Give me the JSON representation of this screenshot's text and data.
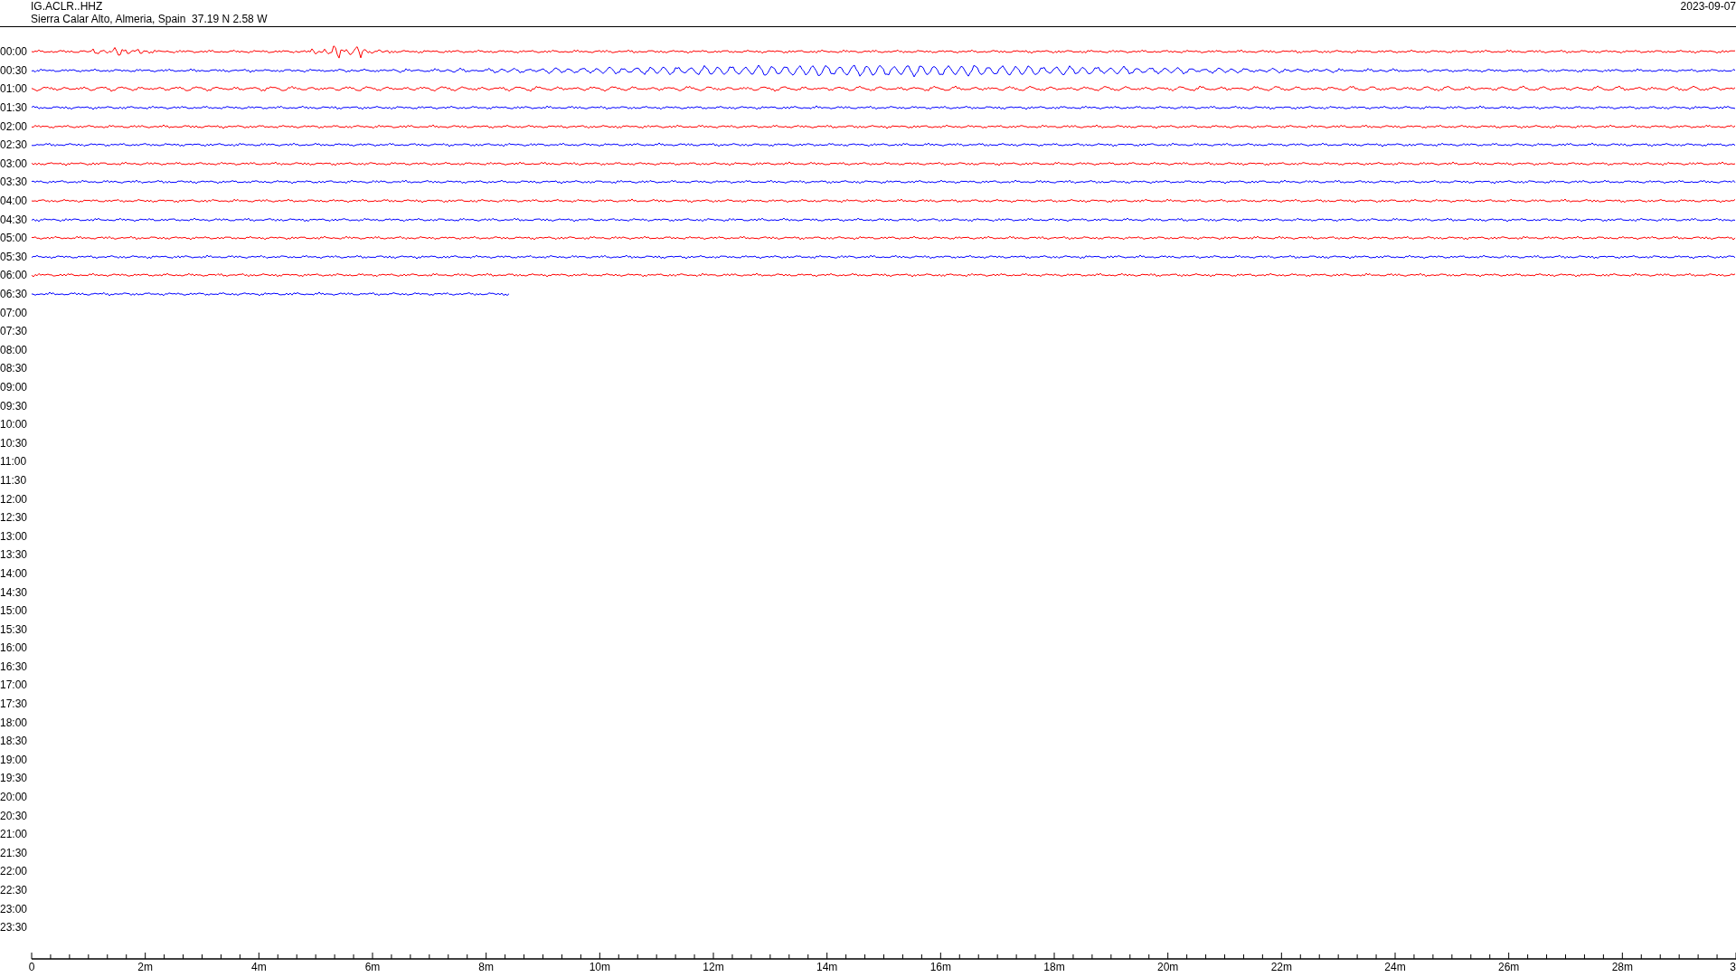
{
  "header": {
    "station": "IG.ACLR..HHZ",
    "location": "Sierra Calar Alto, Almeria, Spain  37.19 N 2.58 W",
    "date": "2023-09-07"
  },
  "rows": [
    {
      "label": "00:00",
      "color": "#ff0000",
      "kind": "full"
    },
    {
      "label": "00:30",
      "color": "#0000ff",
      "kind": "full"
    },
    {
      "label": "01:00",
      "color": "#ff0000",
      "kind": "full"
    },
    {
      "label": "01:30",
      "color": "#0000ff",
      "kind": "full"
    },
    {
      "label": "02:00",
      "color": "#ff0000",
      "kind": "full"
    },
    {
      "label": "02:30",
      "color": "#0000ff",
      "kind": "full"
    },
    {
      "label": "03:00",
      "color": "#ff0000",
      "kind": "full"
    },
    {
      "label": "03:30",
      "color": "#0000ff",
      "kind": "full"
    },
    {
      "label": "04:00",
      "color": "#ff0000",
      "kind": "full"
    },
    {
      "label": "04:30",
      "color": "#0000ff",
      "kind": "full"
    },
    {
      "label": "05:00",
      "color": "#ff0000",
      "kind": "full"
    },
    {
      "label": "05:30",
      "color": "#0000ff",
      "kind": "full"
    },
    {
      "label": "06:00",
      "color": "#ff0000",
      "kind": "full"
    },
    {
      "label": "06:30",
      "color": "#0000ff",
      "kind": "partial"
    },
    {
      "label": "07:00",
      "kind": "empty"
    },
    {
      "label": "07:30",
      "kind": "empty"
    },
    {
      "label": "08:00",
      "kind": "empty"
    },
    {
      "label": "08:30",
      "kind": "empty"
    },
    {
      "label": "09:00",
      "kind": "empty"
    },
    {
      "label": "09:30",
      "kind": "empty"
    },
    {
      "label": "10:00",
      "kind": "empty"
    },
    {
      "label": "10:30",
      "kind": "empty"
    },
    {
      "label": "11:00",
      "kind": "empty"
    },
    {
      "label": "11:30",
      "kind": "empty"
    },
    {
      "label": "12:00",
      "kind": "empty"
    },
    {
      "label": "12:30",
      "kind": "empty"
    },
    {
      "label": "13:00",
      "kind": "empty"
    },
    {
      "label": "13:30",
      "kind": "empty"
    },
    {
      "label": "14:00",
      "kind": "empty"
    },
    {
      "label": "14:30",
      "kind": "empty"
    },
    {
      "label": "15:00",
      "kind": "empty"
    },
    {
      "label": "15:30",
      "kind": "empty"
    },
    {
      "label": "16:00",
      "kind": "empty"
    },
    {
      "label": "16:30",
      "kind": "empty"
    },
    {
      "label": "17:00",
      "kind": "empty"
    },
    {
      "label": "17:30",
      "kind": "empty"
    },
    {
      "label": "18:00",
      "kind": "empty"
    },
    {
      "label": "18:30",
      "kind": "empty"
    },
    {
      "label": "19:00",
      "kind": "empty"
    },
    {
      "label": "19:30",
      "kind": "empty"
    },
    {
      "label": "20:00",
      "kind": "empty"
    },
    {
      "label": "20:30",
      "kind": "empty"
    },
    {
      "label": "21:00",
      "kind": "empty"
    },
    {
      "label": "21:30",
      "kind": "empty"
    },
    {
      "label": "22:00",
      "kind": "empty"
    },
    {
      "label": "22:30",
      "kind": "empty"
    },
    {
      "label": "23:00",
      "kind": "empty"
    },
    {
      "label": "23:30",
      "kind": "empty"
    }
  ],
  "axis": {
    "labels": [
      "0",
      "2m",
      "4m",
      "6m",
      "8m",
      "10m",
      "12m",
      "14m",
      "16m",
      "18m",
      "20m",
      "22m",
      "24m",
      "26m",
      "28m",
      "3"
    ]
  }
}
